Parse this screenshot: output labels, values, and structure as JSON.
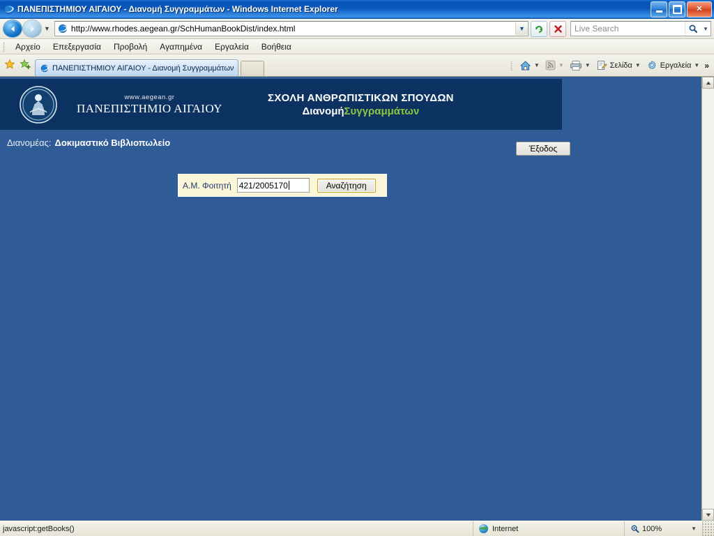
{
  "window": {
    "title": "ΠΑΝΕΠΙΣΤΗΜΙΟΥ ΑΙΓΑΙΟΥ - Διανομή Συγγραμμάτων - Windows Internet Explorer",
    "app_icon": "internet-explorer-icon",
    "minimize_label": "_",
    "restore_label": "❐",
    "close_label": "✕"
  },
  "address_bar": {
    "back_label": "◀",
    "forward_label": "▶",
    "history_dropdown_label": "▼",
    "page_icon": "page-icon",
    "url": "http://www.rhodes.aegean.gr/SchHumanBookDist/index.html",
    "url_dropdown_label": "▼",
    "refresh_label": "↻",
    "stop_label": "✕",
    "search_placeholder": "Live Search",
    "search_go_label": "🔍",
    "search_dropdown_label": "▼"
  },
  "menu": {
    "items": [
      {
        "label": "Αρχείο"
      },
      {
        "label": "Επεξεργασία"
      },
      {
        "label": "Προβολή"
      },
      {
        "label": "Αγαπημένα"
      },
      {
        "label": "Εργαλεία"
      },
      {
        "label": "Βοήθεια"
      }
    ]
  },
  "tabbar": {
    "favorites_center_icon": "star-icon",
    "add_favorite_icon": "star-plus-icon",
    "tab": {
      "icon": "internet-explorer-icon",
      "label": "ΠΑΝΕΠΙΣΤΗΜΙΟΥ ΑΙΓΑΙΟΥ - Διανομή Συγγραμμάτων"
    },
    "new_tab_label": "",
    "tools": [
      {
        "name": "home-icon",
        "label": "",
        "caret": "▼"
      },
      {
        "name": "feeds-icon",
        "label": "",
        "caret": "▼"
      },
      {
        "name": "print-icon",
        "label": "",
        "caret": "▼"
      },
      {
        "name": "page-menu",
        "label": "Σελίδα",
        "caret": "▼"
      },
      {
        "name": "tools-menu",
        "label": "Εργαλεία",
        "caret": "▼"
      }
    ],
    "overflow_label": "»"
  },
  "page": {
    "header": {
      "logo_icon": "aegean-university-emblem",
      "website": "www.aegean.gr",
      "university": "ΠΑΝΕΠΙΣΤΗΜΙΟ ΑΙΓΑΙΟΥ",
      "school_line1": "ΣΧΟΛΗ ΑΝΘΡΩΠΙΣΤΙΚΩΝ ΣΠΟΥΔΩΝ",
      "school_line2_white": "Διανομή",
      "school_line2_green": "Συγγραμμάτων"
    },
    "distributor": {
      "label": "Διανομέας:",
      "name": "Δοκιμαστικό Βιβλιοπωλείο"
    },
    "exit_button": "Έξοδος",
    "search_form": {
      "field_label": "Α.Μ. Φοιτητή",
      "field_value": "421/2005170",
      "submit_label": "Αναζήτηση"
    },
    "scrollbar": {
      "up_label": "▲",
      "down_label": "▼"
    }
  },
  "statusbar": {
    "message": "javascript:getBooks()",
    "zone_icon": "globe-icon",
    "zone": "Internet",
    "zoom_icon": "zoom-icon",
    "zoom": "100%",
    "zoom_dropdown_label": "▼"
  },
  "colors": {
    "titlebar_blue": "#0a57bb",
    "page_blue": "#2f5b96",
    "banner_navy": "#0c3262",
    "accent_green": "#8cc63f",
    "form_yellow": "#fbf6d8",
    "button_gold_border": "#c9a227"
  }
}
